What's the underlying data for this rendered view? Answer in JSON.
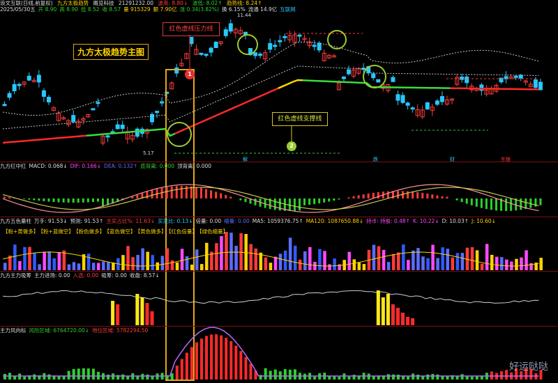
{
  "header": {
    "stock": "浪文互联(日线,前复权)",
    "indicator": "九方太极趋势",
    "sector_label": "概览科技",
    "open_label": "21291232.00",
    "trend_a": "波高: 8.80↓",
    "trend_b": "波低: 8.02↑",
    "trend_line": "趋势线: 8.24↑",
    "line2": [
      {
        "text": "2025/05/30五",
        "color": "#dddddd"
      },
      {
        "text": "开 8.90",
        "color": "#2bd12b"
      },
      {
        "text": "高 8.90",
        "color": "#2bd12b"
      },
      {
        "text": "低 8.52",
        "color": "#2bd12b"
      },
      {
        "text": "收 8.57",
        "color": "#2bd12b"
      },
      {
        "text": "量 915329",
        "color": "#ffd400"
      },
      {
        "text": "额 7.90亿",
        "color": "#ffd400"
      },
      {
        "text": "涨 0.34(3.82%)",
        "color": "#2bd12b"
      },
      {
        "text": "换 6.15%",
        "color": "#dddddd"
      },
      {
        "text": "流通 14.9亿",
        "color": "#dddddd"
      },
      {
        "text": "互联网",
        "color": "#29c7ff"
      }
    ]
  },
  "main_chart": {
    "high_price": "11.44",
    "low_price": "5.17",
    "title_box": "九方太极趋势主图",
    "resistance_label": "红色虚线压力线",
    "support_label": "红色虚线支撑线",
    "badge1": "1",
    "badge2": "2",
    "markers": [
      {
        "text": "解",
        "color": "#29c7ff"
      },
      {
        "text": "跌",
        "color": "#29c7ff"
      },
      {
        "text": "财",
        "color": "#29c7ff"
      },
      {
        "text": "东银",
        "color": "#ff3b3b"
      }
    ]
  },
  "macd": {
    "name": "九方红中红",
    "values": [
      {
        "text": "MACD: 0.068↓",
        "color": "#dddddd"
      },
      {
        "text": "DIF: 0.166↓",
        "color": "#ff49ff"
      },
      {
        "text": "DEA: 0.132↑",
        "color": "#5a6cff"
      },
      {
        "text": "底背离: 0.000",
        "color": "#2bd12b"
      },
      {
        "text": "顶背离: 0.000",
        "color": "#dddddd"
      }
    ]
  },
  "volume": {
    "name": "九方五色量柱",
    "values": [
      {
        "text": "万手: 91.53↓",
        "color": "#dddddd"
      },
      {
        "text": "预测: 91.53↑",
        "color": "#dddddd"
      },
      {
        "text": "主买占比%: 11.63↓",
        "color": "#ff3b3b"
      },
      {
        "text": "买卖比: 0.13↓",
        "color": "#29c7ff"
      },
      {
        "text": "倍量: 0.00",
        "color": "#dddddd"
      },
      {
        "text": "缩量: 0.00",
        "color": "#5a6cff"
      },
      {
        "text": "MA5: 1059376.75↑",
        "color": "#dddddd"
      },
      {
        "text": "MA120: 1087650.88↓",
        "color": "#ffd400"
      },
      {
        "text": "持币: 持股: 0.48↑",
        "color": "#ff49ff"
      },
      {
        "text": "K: 10.22↓",
        "color": "#ff49ff"
      },
      {
        "text": "D: 10.03↑",
        "color": "#dddddd"
      },
      {
        "text": "J: 10.60↓",
        "color": "#ffd400"
      }
    ],
    "legend": [
      {
        "text": "【粉+黄做多】",
        "color": "#ffd400"
      },
      {
        "text": "【粉+蓝做空】",
        "color": "#ffd400"
      },
      {
        "text": "【粉色做多】",
        "color": "#ffd400"
      },
      {
        "text": "【蓝色做空】",
        "color": "#ffd400"
      },
      {
        "text": "【黄色做多】",
        "color": "#ffd400"
      },
      {
        "text": "【红色倍量】",
        "color": "#ffd400"
      },
      {
        "text": "【绿色缩量】",
        "color": "#ffd400"
      }
    ]
  },
  "capital": {
    "name": "九方主力吸筹",
    "values": [
      {
        "text": "主力进场: 0.00",
        "color": "#dddddd"
      },
      {
        "text": "入选: 0.00",
        "color": "#ff3b3b"
      },
      {
        "text": "吸筹: 0.00",
        "color": "#dddddd"
      },
      {
        "text": "收盘: 8.57↓",
        "color": "#dddddd"
      }
    ]
  },
  "wind": {
    "name": "主力风向标",
    "values": [
      {
        "text": "风险区域: 6764720.00↓",
        "color": "#2bd12b"
      },
      {
        "text": "地位区域: 5782294.50",
        "color": "#ff3b3b"
      }
    ]
  },
  "watermark": "好运哒哒"
}
